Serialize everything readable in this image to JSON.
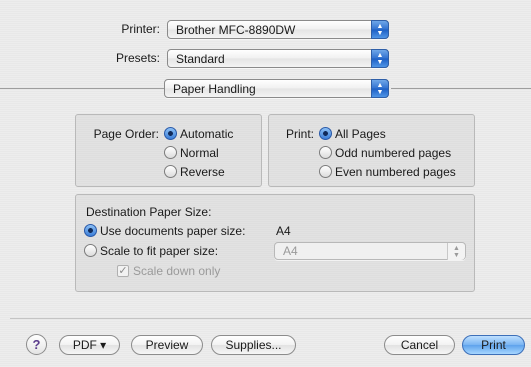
{
  "printer": {
    "label": "Printer:",
    "value": "Brother MFC-8890DW"
  },
  "presets": {
    "label": "Presets:",
    "value": "Standard"
  },
  "panel_selector": {
    "value": "Paper Handling"
  },
  "page_order": {
    "label": "Page Order:",
    "options": [
      "Automatic",
      "Normal",
      "Reverse"
    ],
    "selected": "Automatic"
  },
  "print_range": {
    "label": "Print:",
    "options": [
      "All Pages",
      "Odd numbered pages",
      "Even numbered pages"
    ],
    "selected": "All Pages"
  },
  "destination": {
    "title": "Destination Paper Size:",
    "use_documents_label": "Use documents paper size:",
    "documents_size": "A4",
    "scale_label": "Scale to fit paper size:",
    "scale_size": "A4",
    "scale_down_label": "Scale down only",
    "scale_down_checked": true,
    "selected": "use_documents"
  },
  "buttons": {
    "help": "?",
    "pdf": "PDF ▾",
    "preview": "Preview",
    "supplies": "Supplies...",
    "cancel": "Cancel",
    "print": "Print"
  },
  "colors": {
    "accent": "#3b7ed8",
    "default_button": "#78b4f2"
  }
}
